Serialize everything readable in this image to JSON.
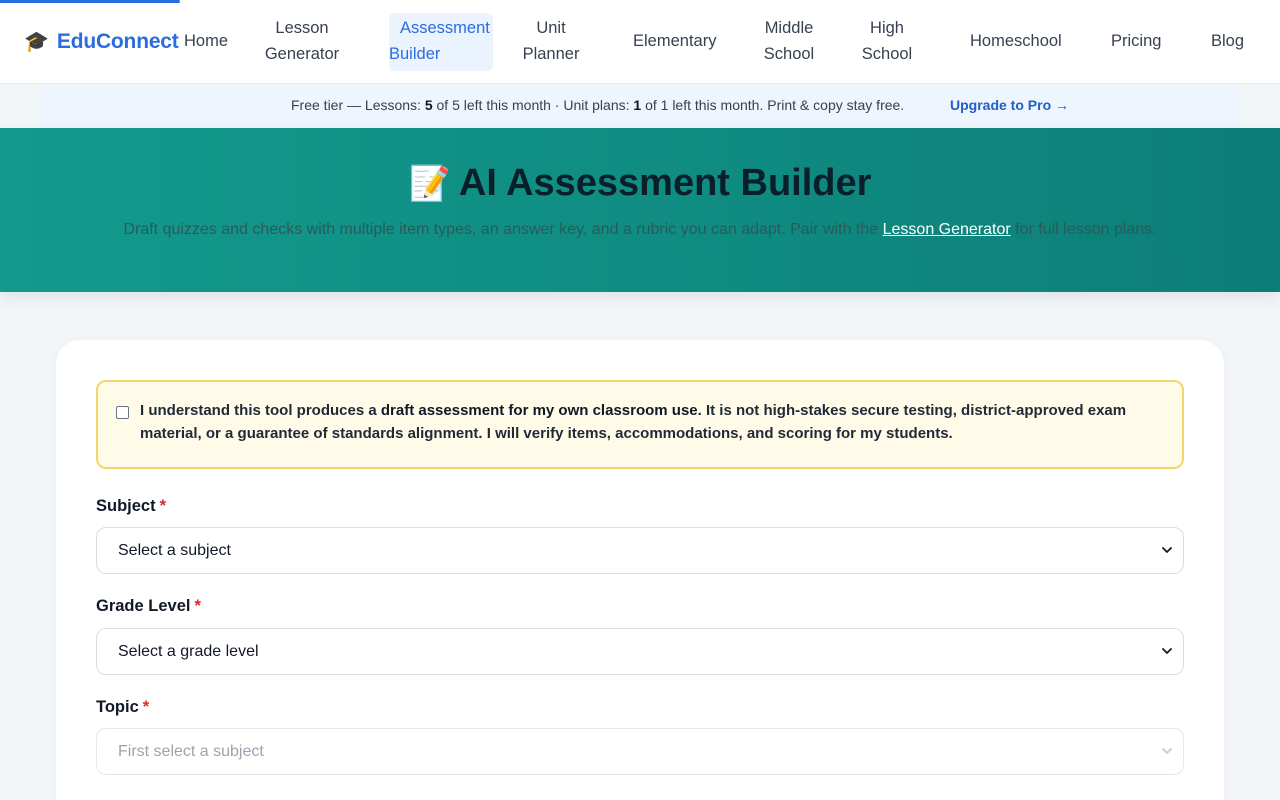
{
  "brand": {
    "icon": "graduation-cap-icon",
    "name": "EduConnect",
    "color": "#2b6cde"
  },
  "nav": {
    "home": "Home",
    "lesson_generator": [
      "Lesson",
      "Generator"
    ],
    "assessment_builder": [
      "Assessment",
      "Builder"
    ],
    "unit_planner": [
      "Unit",
      "Planner"
    ],
    "elementary": "Elementary",
    "middle_school": [
      "Middle",
      "School"
    ],
    "high_school": [
      "High",
      "School"
    ],
    "homeschool": "Homeschool",
    "pricing": "Pricing",
    "blog": "Blog",
    "active": "Assessment Builder"
  },
  "tier": {
    "prefix": "Free tier — Lessons: ",
    "lessons_left": "5",
    "lessons_rest": " of 5 left this month · Unit plans: ",
    "units_left": "1",
    "units_rest": " of 1 left this month. Print & copy stay free.",
    "upgrade": "Upgrade to Pro →"
  },
  "hero": {
    "emoji": "📝",
    "title": "AI Assessment Builder",
    "sub_before": "Draft quizzes and checks with multiple item types, an answer key, and a rubric you can adapt. Pair with the ",
    "sub_link": "Lesson Generator",
    "sub_after": " for full lesson plans.",
    "color": "#139a8c"
  },
  "notice": {
    "checked": false,
    "before": "I understand this tool produces a ",
    "bold": "draft assessment for my own classroom use",
    "after": ". It is not high-stakes secure testing, district-approved exam material, or a guarantee of standards alignment. I will verify items, accommodations, and scoring for my students."
  },
  "form": {
    "subject": {
      "label": "Subject",
      "required": "*",
      "value": "Select a subject"
    },
    "grade": {
      "label": "Grade Level",
      "required": "*",
      "value": "Select a grade level"
    },
    "topic": {
      "label": "Topic",
      "required": "*",
      "value": "First select a subject"
    }
  }
}
